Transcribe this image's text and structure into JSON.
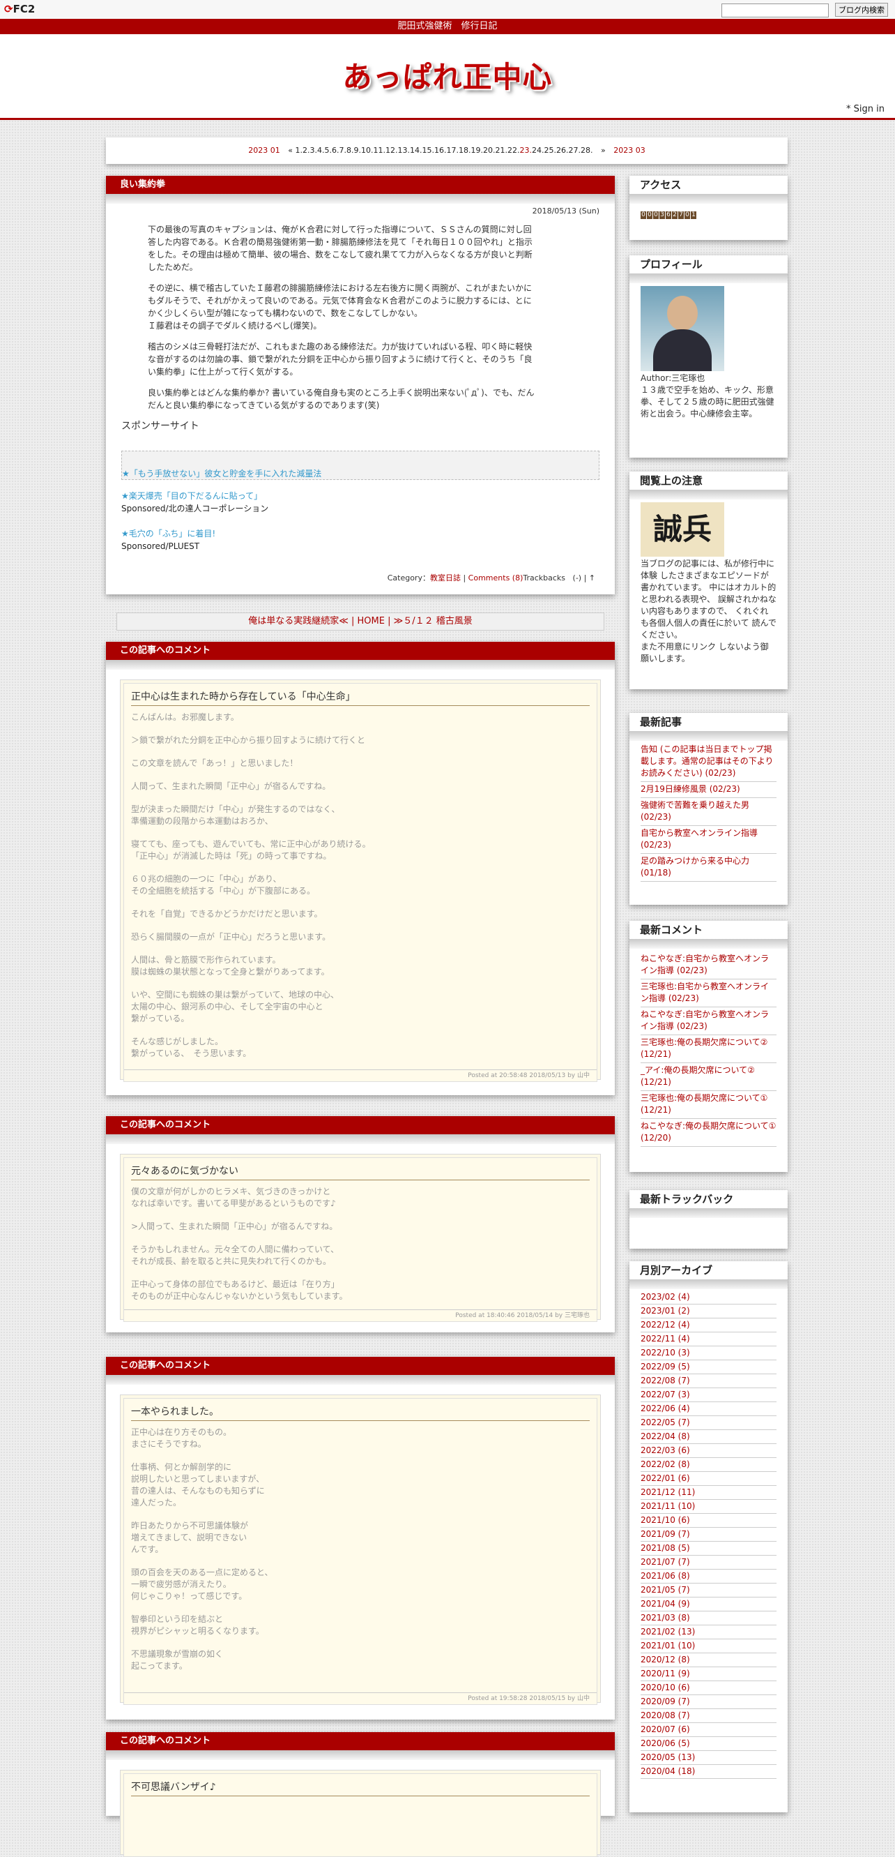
{
  "fc2": {
    "logo": "FC2",
    "search_button": "ブログ内検索",
    "search_value": ""
  },
  "blog": {
    "subtitle": "肥田式強健術　修行日記",
    "title": "あっぱれ正中心",
    "signin": "* Sign in"
  },
  "monthnav": {
    "prev": "2023 01",
    "prev_arrow": "«",
    "days": [
      "1.",
      "2.",
      "3.",
      "4.",
      "5.",
      "6.",
      "7.",
      "8.",
      "9.",
      "10.",
      "11.",
      "12.",
      "13.",
      "14.",
      "15.",
      "16.",
      "17.",
      "18.",
      "19.",
      "20.",
      "21.",
      "22.",
      "23.",
      "24.",
      "25.",
      "26.",
      "27.",
      "28."
    ],
    "next_arrow": "»",
    "next": "2023 03"
  },
  "entry": {
    "title": "良い集約拳",
    "date": "2018/05/13 (Sun)",
    "paragraphs": [
      "下の最後の写真のキャプションは、俺がＫ合君に対して行った指導について、ＳＳさんの質問に対し回答した内容である。Ｋ合君の簡易強健術第一動・腓腸筋練修法を見て「それ毎日１００回やれ」と指示をした。その理由は極めて簡単、彼の場合、数をこなして疲れ果てて力が入らなくなる方が良いと判断したためだ。",
      "その逆に、横で稽古していたＩ藤君の腓腸筋練修法における左右後方に開く両腕が、これがまたいかにもダルそうで、それがかえって良いのである。元気で体育会なＫ合君がこのように脱力するには、とにかく少しくらい型が雑になっても構わないので、数をこなしてしかない。\nＩ藤君はその調子でダルく続けるべし(爆笑)。",
      "稽古のシメは三骨軽打法だが、これもまた趣のある練修法だ。力が抜けていればいる程、叩く時に軽快な音がするのは勿論の事、鎖で繋がれた分銅を正中心から振り回すように続けて行くと、そのうち「良い集約拳」に仕上がって行く気がする。",
      "良い集約拳とはどんな集約拳か? 書いている俺自身も実のところ上手く説明出来ない(ﾟдﾟ)、でも、だんだんと良い集約拳になってきている気がするのであります(笑)"
    ],
    "sponsor_heading": "スポンサーサイト",
    "ads": [
      {
        "link": "★「もう手放せない」彼女と貯金を手に入れた減量法",
        "sponsor": ""
      },
      {
        "link": "★楽天爆売「目の下だるんに貼って」",
        "sponsor": "Sponsored/北の達人コーポレーション"
      },
      {
        "link": "★毛穴の「ふち」に着目!",
        "sponsor": "Sponsored/PLUEST"
      }
    ],
    "category_label": "Category：",
    "category": "教室日誌",
    "separator": " | ",
    "comments": "Comments (8)",
    "trackbacks": "Trackbacks",
    "tail": "(-) | ↑"
  },
  "pagenav": {
    "prev": "俺は単なる実践継続家≪",
    "home": "HOME",
    "next": "≫５/１２ 稽古風景",
    "sep": " | "
  },
  "comment_header": "この記事へのコメント",
  "comments": [
    {
      "title": "正中心は生まれた時から存在している「中心生命」",
      "paras": [
        "こんばんは。お邪魔します。",
        "＞鎖で繋がれた分銅を正中心から振り回すように続けて行くと",
        "この文章を読んで「あっ！」と思いました！",
        "人間って、生まれた瞬間「正中心」が宿るんですね。",
        "型が決まった瞬間だけ「中心」が発生するのではなく、\n準備運動の段階から本運動はおろか、",
        "寝てても、座っても、遊んでいても、常に正中心があり続ける。\n「正中心」が消滅した時は「死」の時って事ですね。",
        "６０兆の細胞の一つに「中心」があり、\nその全細胞を統括する「中心」が下腹部にある。",
        "それを「自覚」できるかどうかだけだと思います。",
        "恐らく腸間膜の一点が「正中心」だろうと思います。",
        "人間は、骨と筋膜で形作られています。\n膜は蜘蛛の巣状態となって全身と繋がりあってます。",
        "いや、空間にも蜘蛛の巣は繋がっていて、地球の中心、\n太陽の中心、銀河系の中心、そして全宇宙の中心と\n繋がっている。",
        "そんな感じがしました。\n繋がっている、　そう思います。"
      ],
      "footer": "Posted at 20:58:48 2018/05/13 by 山中"
    },
    {
      "title": "元々あるのに気づかない",
      "paras": [
        "僕の文章が何がしかのヒラメキ、気づきのきっかけと\nなれば幸いです。書いてる甲斐があるというものです♪",
        ">人間って、生まれた瞬間「正中心」が宿るんですね。",
        "そうかもしれません。元々全ての人間に備わっていて、\nそれが成長、齢を取ると共に見失われて行くのかも。",
        "正中心って身体の部位でもあるけど、最近は「在り方」\nそのものが正中心なんじゃないかという気もしています。"
      ],
      "footer": "Posted at 18:40:46 2018/05/14 by 三宅琢也"
    },
    {
      "title": "一本やられました。",
      "paras": [
        "正中心は在り方そのもの。\nまさにそうですね。",
        "仕事柄、何とか解剖学的に\n説明したいと思ってしまいますが、\n昔の達人は、そんなものも知らずに\n達人だった。",
        "昨日あたりから不可思議体験が\n増えてきまして、説明できない\nんです。",
        "頭の百会を天のある一点に定めると、\n一瞬で疲労感が消えたり。\n何じゃこりゃ！って感じです。",
        "智拳印という印を結ぶと\n視界がピシャッと明るくなります。",
        "不思議現象が雪崩の如く\n起こってます。"
      ],
      "footer": "Posted at 19:58:28 2018/05/15 by 山中"
    },
    {
      "title": "不可思議バンザイ♪",
      "paras": [],
      "footer": ""
    }
  ],
  "sidebar": {
    "access": {
      "title": "アクセス",
      "digits": [
        "0",
        "0",
        "0",
        "3",
        "6",
        "2",
        "7",
        "0",
        "1"
      ]
    },
    "profile": {
      "title": "プロフィール",
      "author": "Author:三宅琢也",
      "text": "１３歳で空手を始め、キック、形意拳、そして２５歳の時に肥田式強健術と出会う。中心練修会主宰。"
    },
    "notice": {
      "title": "閲覧上の注意",
      "image_text": "誠兵",
      "text": "当ブログの記事には、私が修行中に体験 したさまざまなエピソードが書かれています。 中にはオカルト的と思われる表現や、 誤解されかねない内容もありますので、 くれぐれも各個人個人の責任に於いて 読んでください。\nまた不用意にリンク しないよう御願いします。"
    },
    "recent": {
      "title": "最新記事",
      "items": [
        "告知 (この記事は当日までトップ掲載します。通常の記事はその下よりお読みください) (02/23)",
        "2月19日練修風景 (02/23)",
        "強健術で苦難を乗り越えた男 (02/23)",
        "自宅から教室へオンライン指導 (02/23)",
        "足の踏みつけから来る中心力 (01/18)"
      ]
    },
    "recent_comments": {
      "title": "最新コメント",
      "items": [
        "ねこやなぎ:自宅から教室へオンライン指導 (02/23)",
        "三宅琢也:自宅から教室へオンライン指導 (02/23)",
        "ねこやなぎ:自宅から教室へオンライン指導 (02/23)",
        "三宅琢也:俺の長期欠席について② (12/21)",
        "_アイ:俺の長期欠席について② (12/21)",
        "三宅琢也:俺の長期欠席について① (12/21)",
        "ねこやなぎ:俺の長期欠席について① (12/20)"
      ]
    },
    "trackback": {
      "title": "最新トラックバック"
    },
    "archive": {
      "title": "月別アーカイブ",
      "items": [
        "2023/02 (4)",
        "2023/01 (2)",
        "2022/12 (4)",
        "2022/11 (4)",
        "2022/10 (3)",
        "2022/09 (5)",
        "2022/08 (7)",
        "2022/07 (3)",
        "2022/06 (4)",
        "2022/05 (7)",
        "2022/04 (8)",
        "2022/03 (6)",
        "2022/02 (8)",
        "2022/01 (6)",
        "2021/12 (11)",
        "2021/11 (10)",
        "2021/10 (6)",
        "2021/09 (7)",
        "2021/08 (5)",
        "2021/07 (7)",
        "2021/06 (8)",
        "2021/05 (7)",
        "2021/04 (9)",
        "2021/03 (8)",
        "2021/02 (13)",
        "2021/01 (10)",
        "2020/12 (8)",
        "2020/11 (9)",
        "2020/10 (6)",
        "2020/09 (7)",
        "2020/08 (7)",
        "2020/07 (6)",
        "2020/06 (5)",
        "2020/05 (13)",
        "2020/04 (18)"
      ]
    }
  }
}
